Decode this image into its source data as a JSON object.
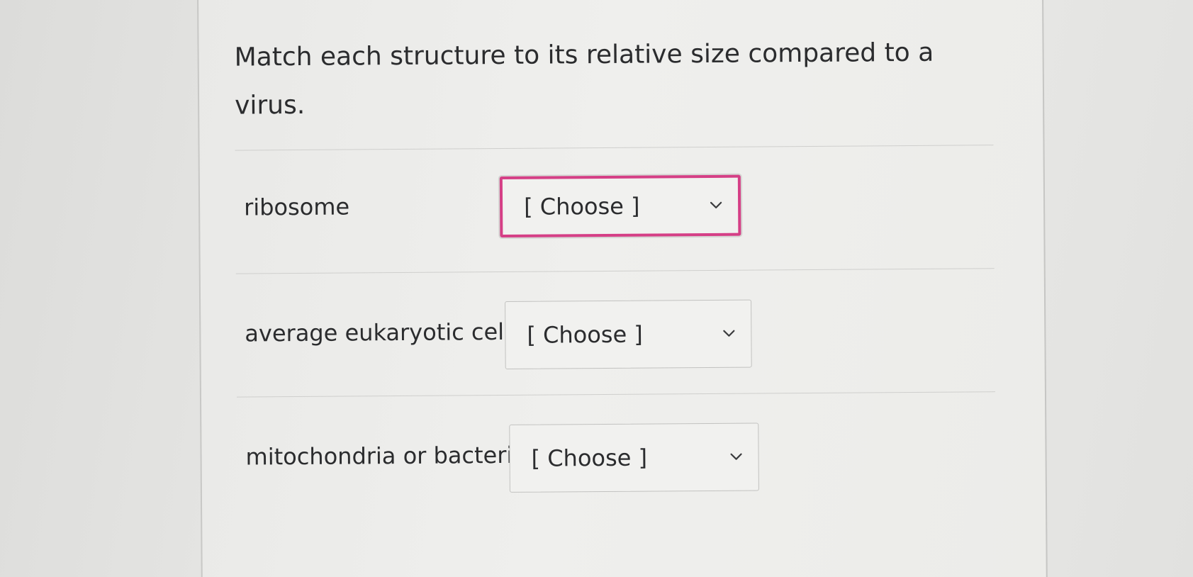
{
  "question": {
    "text": "Match each structure to its relative size compared to a virus."
  },
  "rows": [
    {
      "label": "ribosome",
      "select": {
        "value": "[ Choose ]"
      }
    },
    {
      "label": "average eukaryotic cell",
      "select": {
        "value": "[ Choose ]"
      }
    },
    {
      "label": "mitochondria or bacteria",
      "select": {
        "value": "[ Choose ]"
      }
    }
  ],
  "colors": {
    "focus_ring": "#d53f86",
    "text": "#2b2c2e",
    "border": "#c2c2c0"
  },
  "icons": {
    "dropdown": "chevron-down-icon"
  }
}
